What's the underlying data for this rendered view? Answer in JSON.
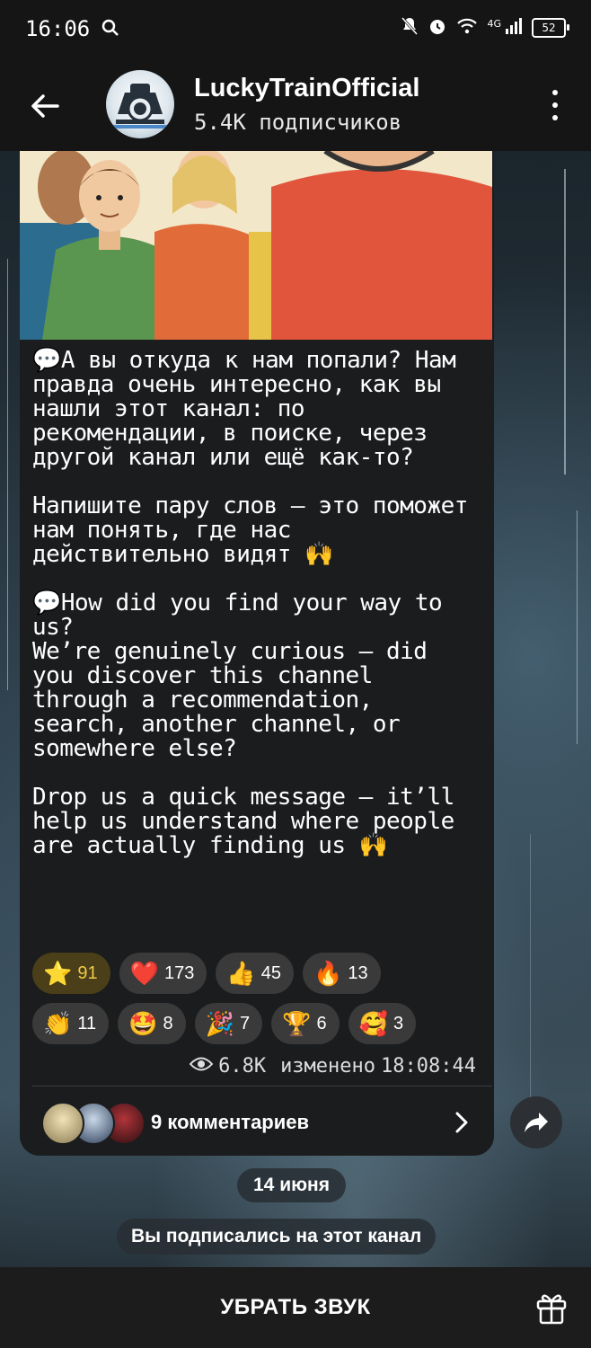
{
  "status_bar": {
    "time": "16:06",
    "network": "4G",
    "battery": "52"
  },
  "header": {
    "channel_name": "LuckyTrainOfficial",
    "subscribers": "5.4K подписчиков"
  },
  "message": {
    "text_ru_1": "💬А вы откуда к нам попали? Нам правда очень интересно, как вы нашли этот канал: по рекомендации, в поиске, через другой канал или ещё как-то?",
    "text_ru_2": "Напишите пару слов — это поможет нам понять, где нас действительно видят 🙌",
    "text_en_1": "💬How did you find your way to us?\nWe’re genuinely curious — did you discover this channel through a recommendation, search, another channel, or somewhere else?",
    "text_en_2": "Drop us a quick message — it’ll help us understand where people are actually finding us 🙌",
    "reactions": [
      {
        "emoji": "⭐",
        "count": "91"
      },
      {
        "emoji": "❤️",
        "count": "173"
      },
      {
        "emoji": "👍",
        "count": "45"
      },
      {
        "emoji": "🔥",
        "count": "13"
      },
      {
        "emoji": "👏",
        "count": "11"
      },
      {
        "emoji": "🤩",
        "count": "8"
      },
      {
        "emoji": "🎉",
        "count": "7"
      },
      {
        "emoji": "🏆",
        "count": "6"
      },
      {
        "emoji": "🥰",
        "count": "3"
      }
    ],
    "views": "6.8K",
    "edited_label": "изменено",
    "time": "18:08:44",
    "comments_label": "9 комментариев"
  },
  "date_separator": "14 июня",
  "service_message": "Вы подписались на этот канал",
  "bottom": {
    "mute_label": "УБРАТЬ ЗВУК"
  },
  "colors": {
    "bubble": "#1a1c1e",
    "active_reaction": "#4a3f18",
    "reaction_chip": "#3a3a3a"
  }
}
